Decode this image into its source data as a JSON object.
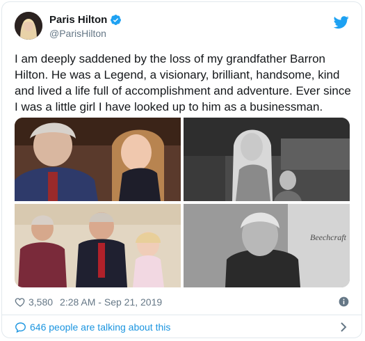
{
  "user": {
    "display_name": "Paris Hilton",
    "handle": "@ParisHilton",
    "verified": true,
    "avatar_icon": "profile-photo"
  },
  "tweet": {
    "text": "I am deeply saddened by the loss of my grandfather Barron Hilton. He was a Legend, a visionary, brilliant, handsome, kind and lived a life full of accomplishment and adventure. Ever since I was a little girl I have looked up to him as a businessman."
  },
  "media": {
    "photo_4_text": "Beechcraft"
  },
  "meta": {
    "likes": "3,580",
    "timestamp": "2:28 AM - Sep 21, 2019"
  },
  "footer": {
    "talking_text": "646 people are talking about this"
  },
  "colors": {
    "twitter_blue": "#1da1f2",
    "link_blue": "#1b95e0",
    "secondary_text": "#657786",
    "border": "#e1e8ed"
  }
}
